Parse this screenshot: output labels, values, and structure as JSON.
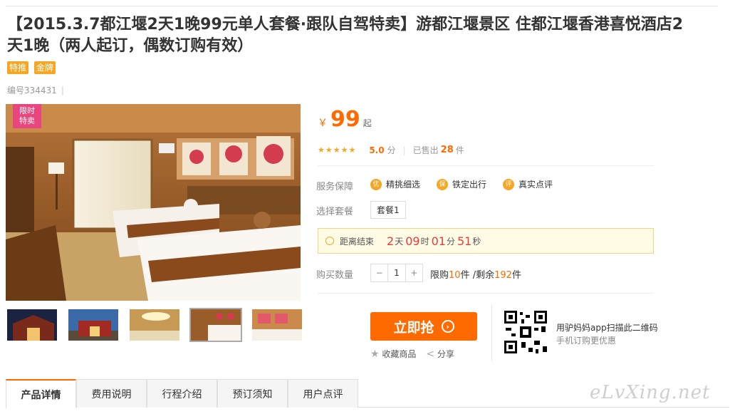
{
  "title": "【2015.3.7都江堰2天1晚99元单人套餐·跟队自驾特卖】游都江堰景区 住都江堰香港喜悦酒店2天1晚（两人起订，偶数订购有效）",
  "tags": [
    "特推",
    "金牌"
  ],
  "code": "编号334431",
  "limit_badge": [
    "限时",
    "特卖"
  ],
  "price": {
    "currency": "￥",
    "amount": "99",
    "suffix": "起"
  },
  "rating": {
    "stars": "★★★★★",
    "score": "5.0",
    "score_unit": "分",
    "sold_prefix": "已售出",
    "sold_count": "28",
    "sold_unit": "件"
  },
  "service": {
    "label": "服务保障",
    "items": [
      {
        "icon": "优",
        "text": "精挑细选"
      },
      {
        "icon": "保",
        "text": "铁定出行"
      },
      {
        "icon": "评",
        "text": "真实点评"
      }
    ]
  },
  "package": {
    "label": "选择套餐",
    "value": "套餐1"
  },
  "countdown": {
    "label": "距离结束",
    "days": "2",
    "d_unit": "天",
    "hours": "09",
    "h_unit": "时",
    "minutes": "01",
    "m_unit": "分",
    "seconds": "51",
    "s_unit": "秒"
  },
  "quantity": {
    "label": "购买数量",
    "minus": "−",
    "value": "1",
    "plus": "+",
    "limit_pre": "限购",
    "limit": "10",
    "limit_unit": "件",
    "rem_pre": "/剩余",
    "remaining": "192",
    "rem_unit": "件"
  },
  "buy_button": "立即抢",
  "favorite": "收藏商品",
  "share": "分享",
  "qr": {
    "line1": "用驴妈妈app扫描此二维码",
    "line2": "手机订购更优惠"
  },
  "tabs": [
    "产品详情",
    "费用说明",
    "行程介绍",
    "预订须知",
    "用户点评"
  ],
  "watermark": "eLvXing.net",
  "colors": {
    "accent": "#ff6a00",
    "badge": "#e9457e",
    "tag": "#f6a623"
  }
}
